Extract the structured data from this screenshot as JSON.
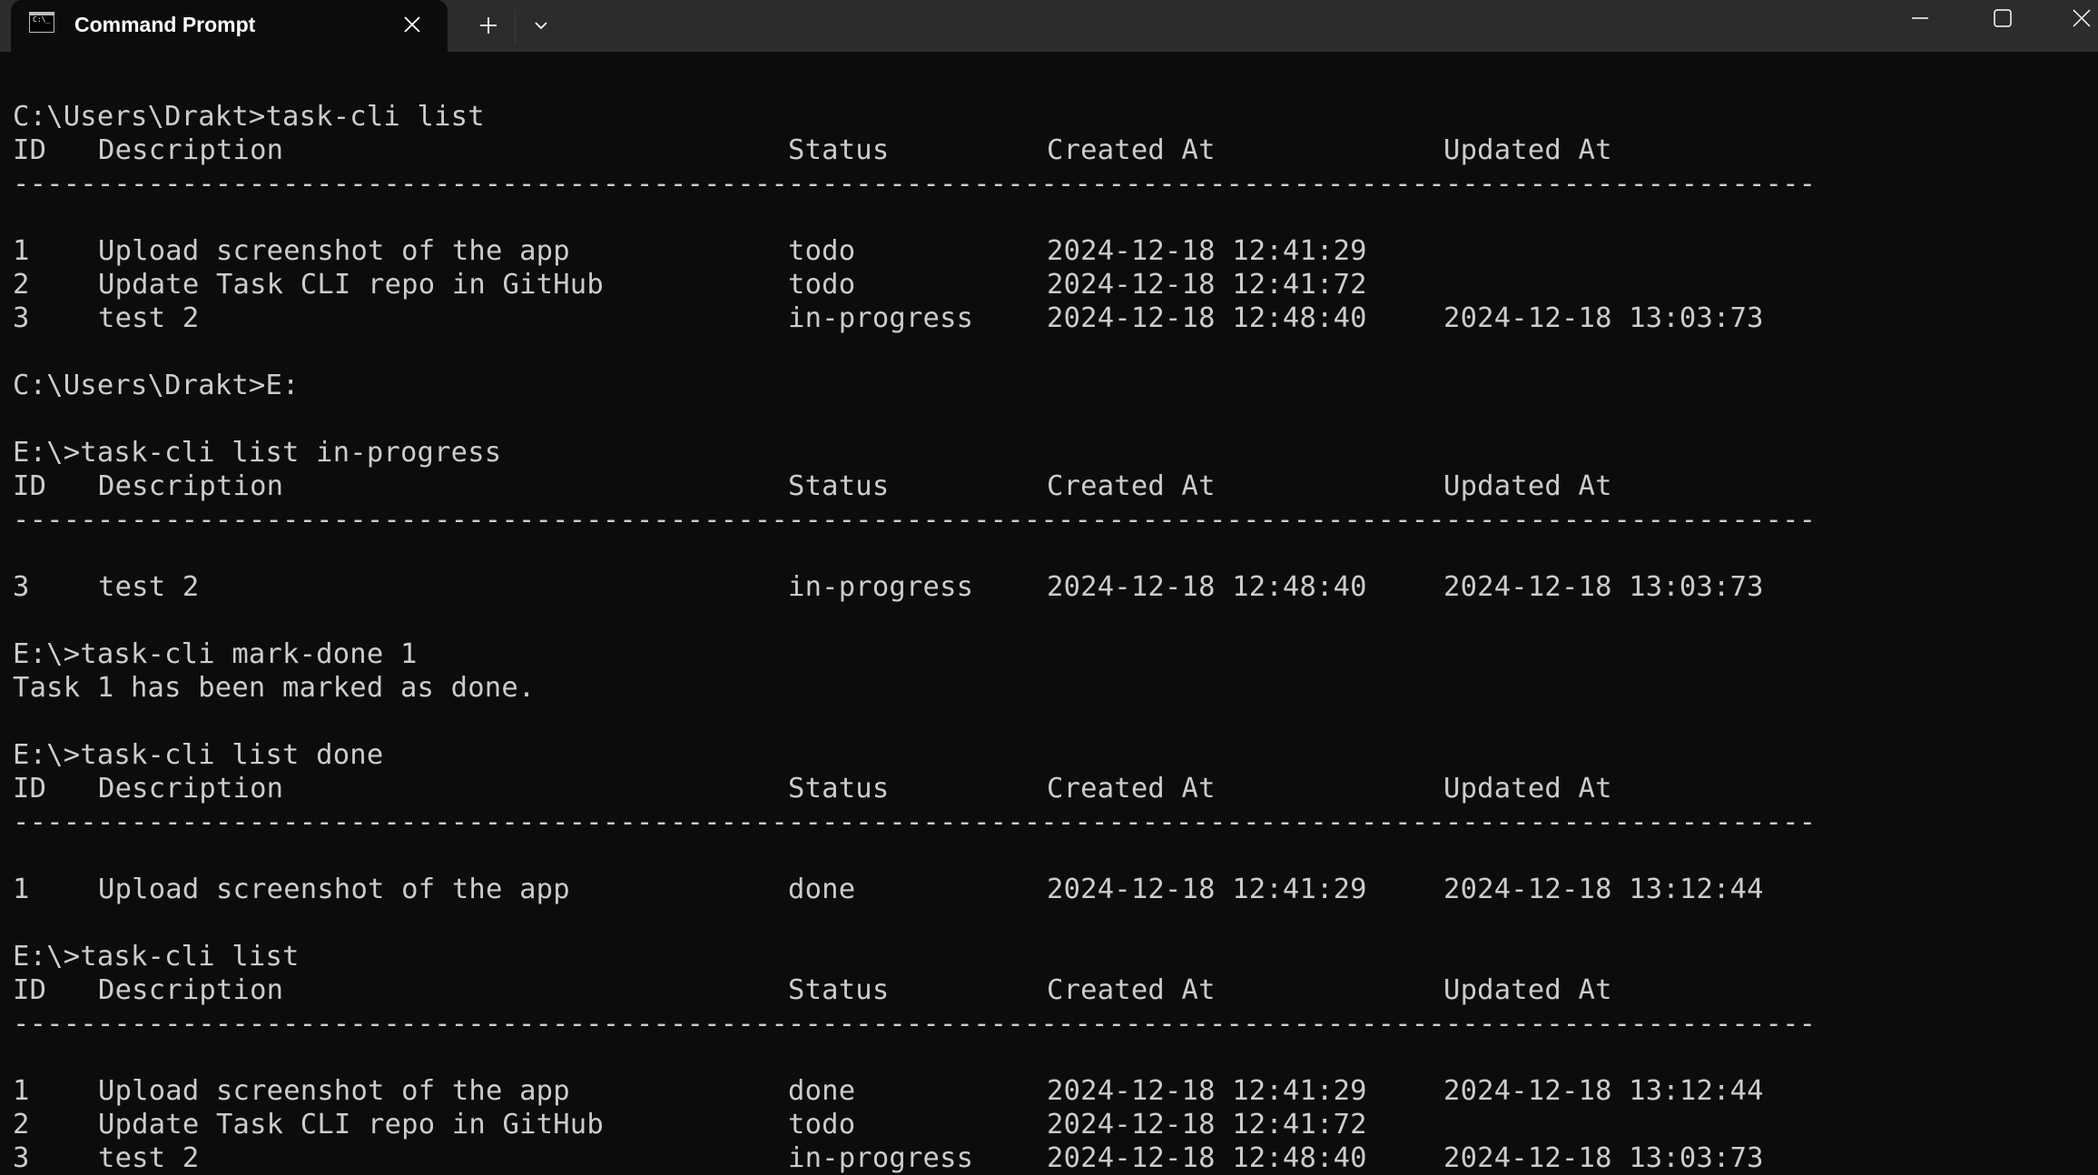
{
  "window": {
    "tab_title": "Command Prompt",
    "tab_icon": "cmd-icon",
    "close_tab_icon": "close-icon",
    "new_tab_icon": "plus-icon",
    "dropdown_icon": "chevron-down-icon",
    "minimize_icon": "minimize-icon",
    "maximize_icon": "maximize-icon",
    "close_window_icon": "close-icon",
    "cmd_glyph": "C:\\_"
  },
  "colors": {
    "terminal_bg": "#0c0c0c",
    "terminal_fg": "#cccccc",
    "titlebar_bg": "#2c2c2c"
  },
  "table_header": {
    "id": "ID",
    "description": "Description",
    "status": "Status",
    "created_at": "Created At",
    "updated_at": "Updated At",
    "separator": "-----------------------------------------------------------------------------------------------------------"
  },
  "blocks": [
    {
      "prompt": "C:\\Users\\Drakt>task-cli list",
      "rows": [
        {
          "id": "1",
          "description": "Upload screenshot of the app",
          "status": "todo",
          "created_at": "2024-12-18 12:41:29",
          "updated_at": ""
        },
        {
          "id": "2",
          "description": "Update Task CLI repo in GitHub",
          "status": "todo",
          "created_at": "2024-12-18 12:41:72",
          "updated_at": ""
        },
        {
          "id": "3",
          "description": "test 2",
          "status": "in-progress",
          "created_at": "2024-12-18 12:48:40",
          "updated_at": "2024-12-18 13:03:73"
        }
      ]
    },
    {
      "prompt": "C:\\Users\\Drakt>E:"
    },
    {
      "prompt": "E:\\>task-cli list in-progress",
      "rows": [
        {
          "id": "3",
          "description": "test 2",
          "status": "in-progress",
          "created_at": "2024-12-18 12:48:40",
          "updated_at": "2024-12-18 13:03:73"
        }
      ]
    },
    {
      "prompt": "E:\\>task-cli mark-done 1",
      "output": "Task 1 has been marked as done."
    },
    {
      "prompt": "E:\\>task-cli list done",
      "rows": [
        {
          "id": "1",
          "description": "Upload screenshot of the app",
          "status": "done",
          "created_at": "2024-12-18 12:41:29",
          "updated_at": "2024-12-18 13:12:44"
        }
      ]
    },
    {
      "prompt": "E:\\>task-cli list",
      "rows": [
        {
          "id": "1",
          "description": "Upload screenshot of the app",
          "status": "done",
          "created_at": "2024-12-18 12:41:29",
          "updated_at": "2024-12-18 13:12:44"
        },
        {
          "id": "2",
          "description": "Update Task CLI repo in GitHub",
          "status": "todo",
          "created_at": "2024-12-18 12:41:72",
          "updated_at": ""
        },
        {
          "id": "3",
          "description": "test 2",
          "status": "in-progress",
          "created_at": "2024-12-18 12:48:40",
          "updated_at": "2024-12-18 13:03:73"
        }
      ]
    }
  ]
}
